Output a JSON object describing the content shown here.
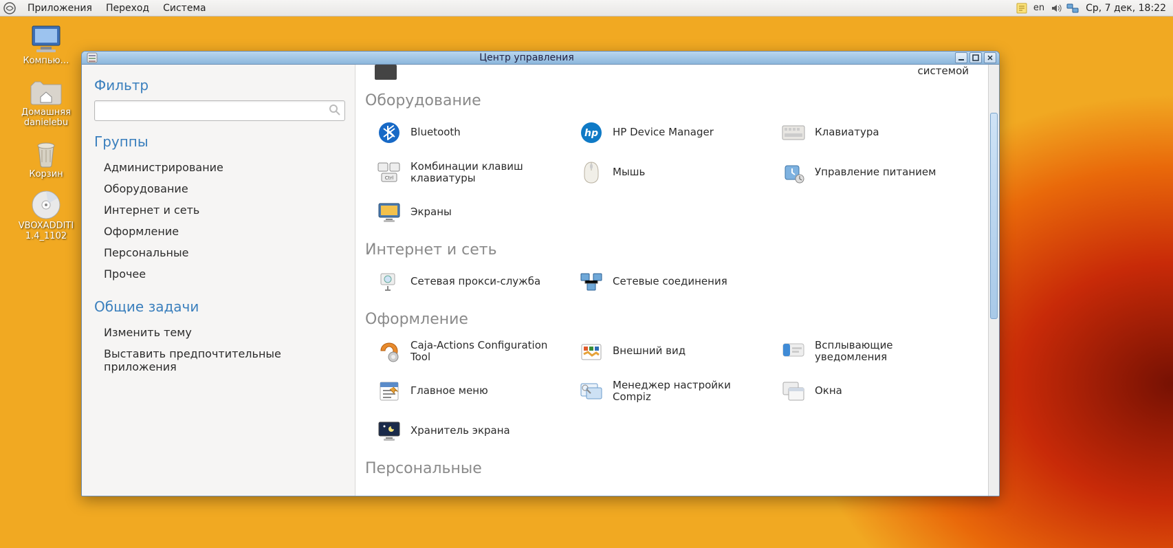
{
  "panel": {
    "menus": [
      "Приложения",
      "Переход",
      "Система"
    ],
    "lang": "en",
    "clock": "Ср,  7 дек, 18:22"
  },
  "desktop": {
    "items": [
      {
        "id": "computer",
        "label": "Компью…"
      },
      {
        "id": "home",
        "label": "Домашняя\ndanielebu"
      },
      {
        "id": "trash",
        "label": "Корзин"
      },
      {
        "id": "disc",
        "label": "VBOXADDITI\n1.4_1102"
      }
    ]
  },
  "window": {
    "title": "Центр управления",
    "sidebar": {
      "filter_label": "Фильтр",
      "search_placeholder": "",
      "groups_label": "Группы",
      "groups": [
        "Администрирование",
        "Оборудование",
        "Интернет и сеть",
        "Оформление",
        "Персональные",
        "Прочее"
      ],
      "tasks_label": "Общие задачи",
      "tasks": [
        "Изменить тему",
        "Выставить предпочтительные приложения"
      ]
    },
    "content": {
      "partial_top_right": "системой",
      "sections": [
        {
          "title": "Оборудование",
          "items": [
            {
              "id": "bluetooth",
              "label": "Bluetooth"
            },
            {
              "id": "hp",
              "label": "HP Device Manager"
            },
            {
              "id": "keyboard",
              "label": "Клавиатура"
            },
            {
              "id": "keyshort",
              "label": "Комбинации клавиш клавиатуры"
            },
            {
              "id": "mouse",
              "label": "Мышь"
            },
            {
              "id": "power",
              "label": "Управление питанием"
            },
            {
              "id": "screens",
              "label": "Экраны"
            }
          ]
        },
        {
          "title": "Интернет и сеть",
          "items": [
            {
              "id": "proxy",
              "label": "Сетевая прокси-служба"
            },
            {
              "id": "netconn",
              "label": "Сетевые соединения"
            }
          ]
        },
        {
          "title": "Оформление",
          "items": [
            {
              "id": "caja",
              "label": "Caja-Actions Configuration Tool"
            },
            {
              "id": "appearance",
              "label": "Внешний вид"
            },
            {
              "id": "notify",
              "label": "Всплывающие уведомления"
            },
            {
              "id": "mainmenu",
              "label": "Главное меню"
            },
            {
              "id": "compiz",
              "label": "Менеджер настройки Compiz"
            },
            {
              "id": "windows",
              "label": "Окна"
            },
            {
              "id": "screensaver",
              "label": "Хранитель экрана"
            }
          ]
        },
        {
          "title": "Персональные",
          "items": []
        }
      ]
    }
  }
}
